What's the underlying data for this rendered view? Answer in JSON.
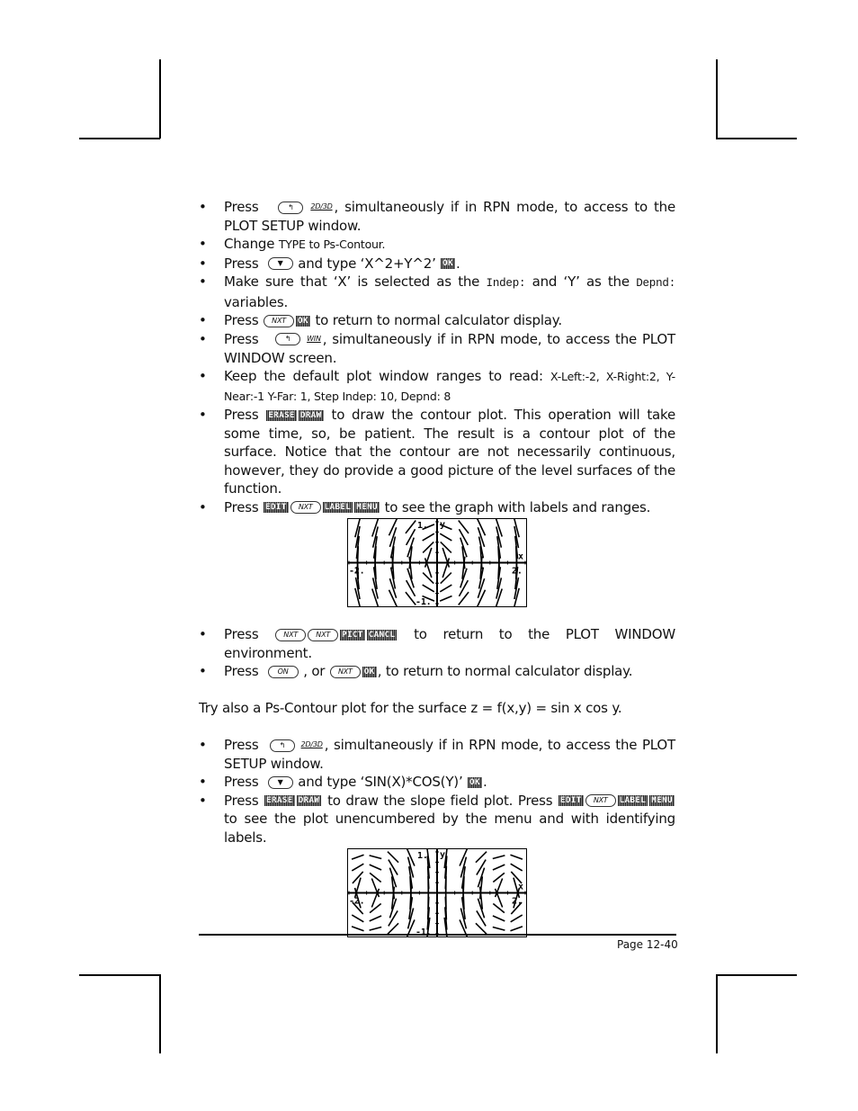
{
  "steps_a": [
    {
      "pre": "Press",
      "keys": [
        {
          "type": "hw",
          "label": "left-shift"
        },
        {
          "type": "label",
          "label": "2D/3D"
        }
      ],
      "post": ", simultaneously if in RPN mode, to access to the PLOT SETUP window."
    },
    {
      "pre": "Change ",
      "small1": "TYPE",
      "mid": " to ",
      "small2": "Ps-Contour."
    },
    {
      "pre": "Press",
      "keys": [
        {
          "type": "hw",
          "label": "down-arrow"
        }
      ],
      "post_a": " and type ‘X^2+Y^2’ ",
      "soft": "OK",
      "post_b": "."
    },
    {
      "pre": "Make sure that ‘X’ is selected as the ",
      "mono1": "Indep:",
      "mid": " and ‘Y’ as the ",
      "mono2": "Depnd:",
      "post": " variables."
    },
    {
      "pre": "Press",
      "key1": "NXT",
      "soft": "OK",
      "post": " to return to normal calculator display."
    },
    {
      "pre": "Press",
      "keylabel": "WIN",
      "post": ", simultaneously if in RPN mode, to access the PLOT WINDOW screen."
    },
    {
      "pre": "Keep the default plot window ranges to read: ",
      "small": "X-Left:-2, X-Right:2, Y-Near:-1 Y-Far: 1, Step Indep: 10, Depnd: 8"
    },
    {
      "pre": "Press",
      "soft1": "ERASE",
      "soft2": "DRAW",
      "post": " to draw the contour plot.   This operation will take some time, so, be patient. The result is a contour plot of the surface.   Notice that the contour are not necessarily continuous, however, they do provide a good picture of the level surfaces of the function."
    },
    {
      "pre": "Press",
      "soft1": "EDIT",
      "key": "NXT",
      "soft2": "LABEL",
      "soft3": "MENU",
      "post": " to see the graph with labels and ranges."
    }
  ],
  "steps_b": [
    {
      "pre": "Press",
      "key1": "NXT",
      "key2": "NXT",
      "soft1": "PICT",
      "soft2": "CANCL",
      "post": " to return to the PLOT WINDOW environment."
    },
    {
      "pre": "Press",
      "key1": "ON",
      "mid": " , or",
      "key2": "NXT",
      "soft": "OK",
      "post": ", to return to normal calculator display."
    }
  ],
  "paragraph": "Try also a Ps-Contour plot for the surface z = f(x,y) = sin x cos y.",
  "steps_c": [
    {
      "pre": "Press",
      "keylabel": "2D/3D",
      "post": ", simultaneously if in RPN mode, to access the PLOT SETUP window."
    },
    {
      "pre": "Press",
      "post_a": " and type ‘SIN(X)*COS(Y)’ ",
      "soft": "OK",
      "post_b": "."
    },
    {
      "pre": "Press",
      "soft1": "ERASE",
      "soft2": "DRAW",
      "mid": " to draw the slope field plot.   Press",
      "soft3": "EDIT",
      "key": "NXT",
      "soft4": "LABEL",
      "soft5": "MENU",
      "post": " to see the plot unencumbered by the menu and with identifying labels."
    }
  ],
  "plots": {
    "plot1": {
      "function": "X^2+Y^2",
      "labels": {
        "ytop": "1.",
        "ybottom": "-1.",
        "xleft": "-2.",
        "xright": "2.",
        "xaxis": "x",
        "yaxis": "y"
      }
    },
    "plot2": {
      "function": "SIN(X)*COS(Y)",
      "labels": {
        "ytop": "1.",
        "ybottom": "-1.",
        "xleft": "-2.",
        "xright": "2.",
        "xaxis": "x",
        "yaxis": "y"
      }
    }
  },
  "footer": {
    "page": "Page 12-40"
  },
  "bullet": "•"
}
